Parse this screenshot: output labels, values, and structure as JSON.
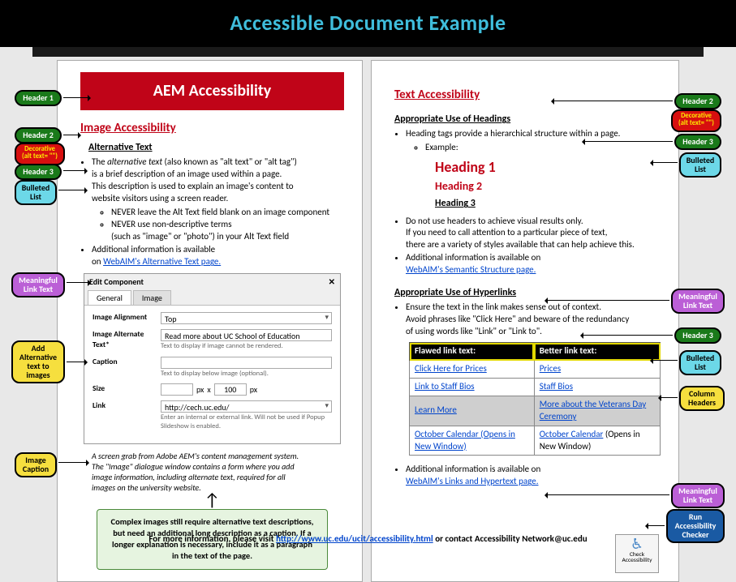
{
  "banner": "Accessible Document Example",
  "page1": {
    "aem_title": "AEM Accessibility",
    "h2": "Image Accessibility",
    "h3": "Alternative Text",
    "b1_prefix": "The ",
    "b1_em": "alternative text",
    "b1_suffix": " (also known as \"alt text\" or \"alt tag\")",
    "b1_line2": "is a brief description of an image used within a page.",
    "b1_line3": "This description is used to explain an image's content to",
    "b1_line4": "website visitors using a screen reader.",
    "sub1": "NEVER leave the Alt Text field blank on an image component",
    "sub2": "NEVER use non-descriptive terms",
    "sub2b": "(such as \"image\" or \"photo\") in your Alt Text field",
    "b3": "Additional information is available",
    "b3_on": "on ",
    "b3_link": "WebAIM's Alternative Text page.",
    "edit": {
      "title": "Edit Component",
      "tab1": "General",
      "tab2": "Image",
      "lab_align": "Image Alignment",
      "val_align": "Top",
      "lab_alt": "Image Alternate Text*",
      "val_alt": "Read more about UC School of Education",
      "hint_alt": "Text to display if image cannot be rendered.",
      "lab_caption": "Caption",
      "hint_caption": "Text to display below image (optional).",
      "lab_size": "Size",
      "val_size_w": "",
      "px": "px",
      "x": "x",
      "val_size_h": "100",
      "lab_link": "Link",
      "val_link": "http://cech.uc.edu/",
      "hint_link": "Enter an internal or external link. Will not be used if Popup Slideshow is enabled."
    },
    "caption_l1": "A screen grab from Adobe AEM's content management system.",
    "caption_l2": "The \"Image\" dialogue window contains a form where you add",
    "caption_l3": "image information, including alternate text, required for all",
    "caption_l4": "images on the university website.",
    "note": "Complex images still require alternative text descriptions, but need an additional long description as a caption. If a longer explanation is necessary, include it as a paragraph in the text of the page."
  },
  "page2": {
    "h2": "Text Accessibility",
    "h3a": "Appropriate Use of Headings",
    "b1": "Heading tags provide a hierarchical structure within a page.",
    "ex": "Example:",
    "ex_h1": "Heading 1",
    "ex_h2": "Heading 2",
    "ex_h3": "Heading 3",
    "b2a": "Do not use headers to achieve visual results only.",
    "b2b": "If you need to call attention to a particular piece of text,",
    "b2c": "there are a variety of styles available that can help achieve this.",
    "b3": "Additional information is available on",
    "b3_link": "WebAIM's Semantic Structure page.",
    "h3b": "Appropriate Use of Hyperlinks",
    "c1a": "Ensure the text in the link makes sense out of context.",
    "c1b": "Avoid phrases like \"Click Here\" and beware of the redundancy",
    "c1c": "of using words like \"Link\" or \"Link to\".",
    "th1": "Flawed link text:",
    "th2": "Better link text:",
    "r1a": "Click Here for Prices",
    "r1b": "Prices",
    "r2a": "Link to Staff Bios",
    "r2b": "Staff Bios",
    "r3a": "Learn More",
    "r3b": "More about the Veterans Day Ceremony",
    "r4a": "October Calendar (Opens in New Window)",
    "r4b_link": "October Calendar",
    "r4b_rest": "(Opens in New Window)",
    "d1": "Additional information is available on",
    "d1_link": "WebAIM's Links and Hypertext page.",
    "checker_label": "Check Accessibility"
  },
  "tags": {
    "header1": "Header 1",
    "header2": "Header 2",
    "decor": "Decorative (alt text= \"\")",
    "header3": "Header 3",
    "bulleted": "Bulleted List",
    "meaningful": "Meaningful Link Text",
    "addalt": "Add Alternative text to images",
    "caption": "Image Caption",
    "colhead": "Column Headers",
    "runcheck": "Run Accessibility Checker"
  },
  "foot_prefix": "For more information, please visit ",
  "foot_link": "http://www.uc.edu/ucit/accessibility.html",
  "foot_suffix": " or contact Accessibility Network@uc.edu"
}
